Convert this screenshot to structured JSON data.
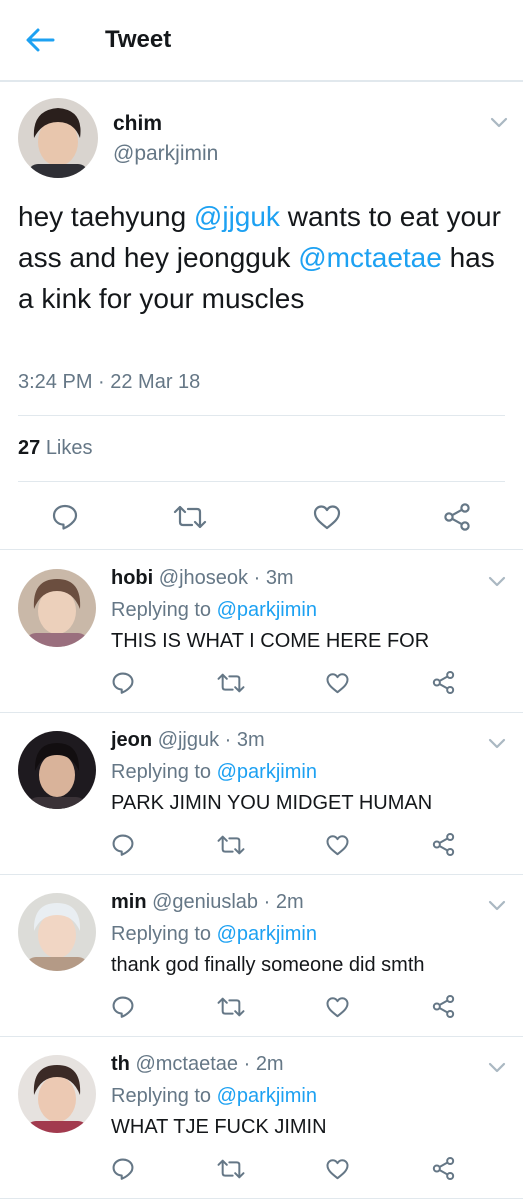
{
  "header": {
    "title": "Tweet"
  },
  "tweet": {
    "name": "chim",
    "handle": "@parkjimin",
    "text": {
      "t1": "hey taehyung ",
      "m1": "@jjguk",
      "t2": " wants to eat your ass and hey jeongguk ",
      "m2": "@mctaetae",
      "t3": " has a kink for your muscles"
    },
    "timestamp": "3:24 PM · 22 Mar 18",
    "likes_count": "27",
    "likes_label": "Likes"
  },
  "replies": [
    {
      "name": "hobi",
      "handle": "@jhoseok",
      "time": "3m",
      "replying_label": "Replying to",
      "replying_handle": "@parkjimin",
      "text": "THIS IS WHAT I COME HERE FOR"
    },
    {
      "name": "jeon",
      "handle": "@jjguk",
      "time": "3m",
      "replying_label": "Replying to",
      "replying_handle": "@parkjimin",
      "text": "PARK JIMIN YOU MIDGET HUMAN"
    },
    {
      "name": "min",
      "handle": "@geniuslab",
      "time": "2m",
      "replying_label": "Replying to",
      "replying_handle": "@parkjimin",
      "text": "thank god finally someone did smth"
    },
    {
      "name": "th",
      "handle": "@mctaetae",
      "time": "2m",
      "replying_label": "Replying to",
      "replying_handle": "@parkjimin",
      "text": "WHAT TJE FUCK JIMIN"
    }
  ],
  "icons": {
    "back": "arrow-left-icon",
    "caret": "chevron-down-icon",
    "reply": "comment-icon",
    "retweet": "retweet-icon",
    "like": "heart-icon",
    "share": "share-icon"
  },
  "colors": {
    "accent": "#1da1f2",
    "secondary_text": "#657786",
    "divider": "#e1e8ed"
  }
}
